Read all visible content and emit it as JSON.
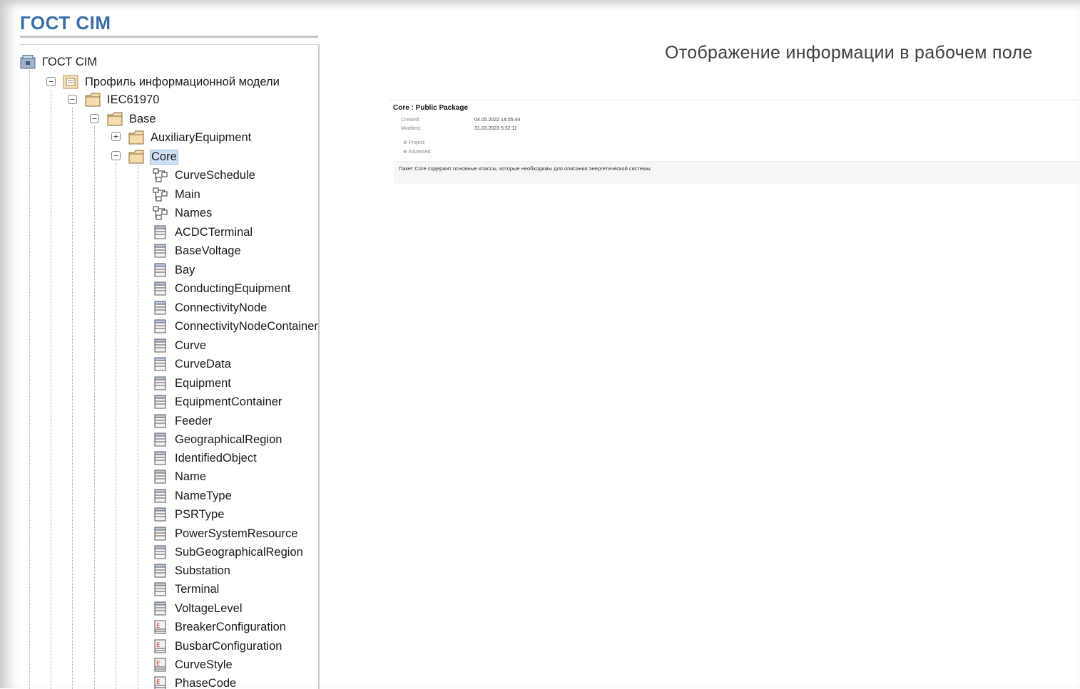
{
  "app": {
    "title": "ГОСТ CIM"
  },
  "heading": "Отображение информации в рабочем поле",
  "tree": {
    "root": "ГОСТ CIM",
    "profile": "Профиль информационной модели",
    "iec": "IEC61970",
    "base": "Base",
    "auxiliary": "AuxiliaryEquipment",
    "core": "Core",
    "diagrams": [
      "CurveSchedule",
      "Main",
      "Names"
    ],
    "classes": [
      "ACDCTerminal",
      "BaseVoltage",
      "Bay",
      "ConductingEquipment",
      "ConnectivityNode",
      "ConnectivityNodeContainer",
      "Curve",
      "CurveData",
      "Equipment",
      "EquipmentContainer",
      "Feeder",
      "GeographicalRegion",
      "IdentifiedObject",
      "Name",
      "NameType",
      "PSRType",
      "PowerSystemResource",
      "SubGeographicalRegion",
      "Substation",
      "Terminal",
      "VoltageLevel"
    ],
    "enums": [
      "BreakerConfiguration",
      "BusbarConfiguration",
      "CurveStyle",
      "PhaseCode"
    ]
  },
  "details": {
    "title": "Core : Public Package",
    "created_label": "Created:",
    "created_value": "04.05.2022 14:05:44",
    "modified_label": "Modified:",
    "modified_value": "31.03.2023 5:32:11",
    "project_label": "Project:",
    "advanced_label": "Advanced:",
    "description": "Пакет Core содержит основные классы, которые необходимы для описания энергетической системы."
  },
  "colors": {
    "title": "#3a6ea8",
    "selection": "#cfe0f5",
    "folder": "#f3dcae"
  }
}
